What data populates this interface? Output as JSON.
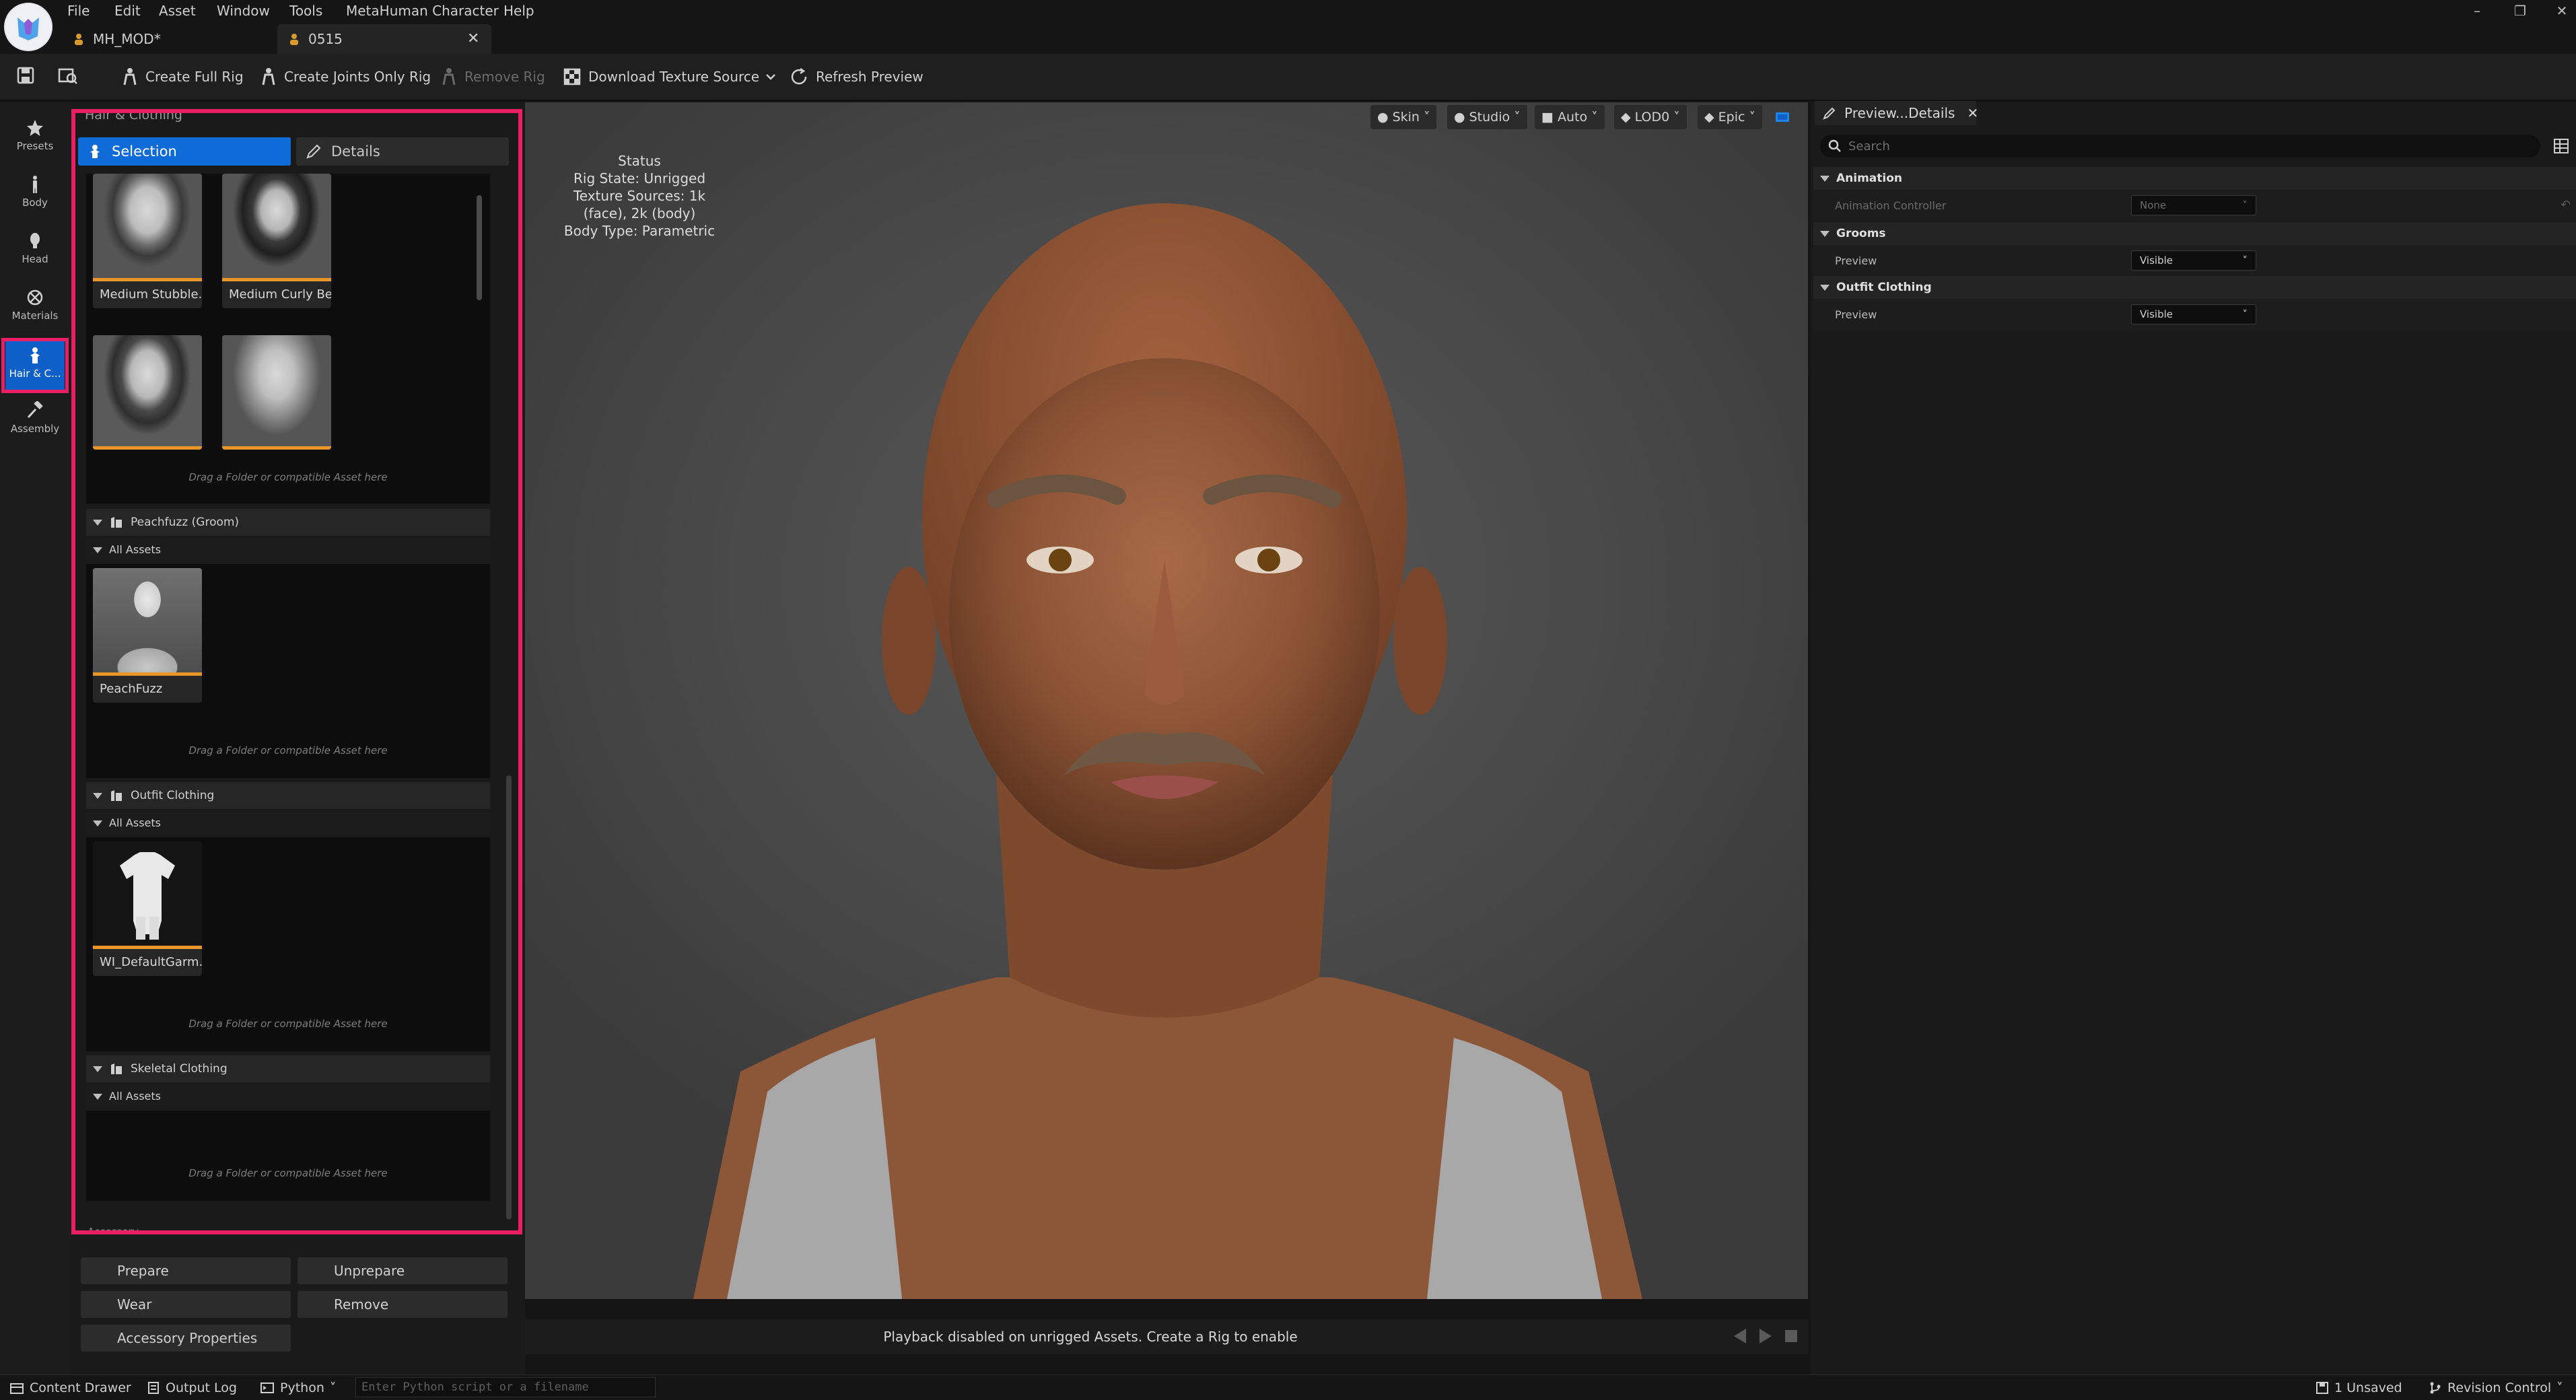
{
  "menu": [
    "File",
    "Edit",
    "Asset",
    "Window",
    "Tools",
    "MetaHuman Character",
    "Help"
  ],
  "tabs": [
    {
      "label": "MH_MOD*"
    },
    {
      "label": "0515"
    }
  ],
  "toolbar": {
    "create_full_rig": "Create Full Rig",
    "create_joints_only_rig": "Create Joints Only Rig",
    "remove_rig": "Remove Rig",
    "download_texture_source": "Download Texture Source",
    "refresh_preview": "Refresh Preview"
  },
  "modes": [
    {
      "label": "Presets",
      "icon": "star-icon"
    },
    {
      "label": "Body",
      "icon": "body-icon"
    },
    {
      "label": "Head",
      "icon": "head-icon"
    },
    {
      "label": "Materials",
      "icon": "materials-icon"
    },
    {
      "label": "Hair & C...",
      "icon": "hair-icon",
      "active": true
    },
    {
      "label": "Assembly",
      "icon": "hammer-icon"
    }
  ],
  "left_panel": {
    "title": "Hair & Clothing",
    "segments": [
      "Selection",
      "Details"
    ],
    "beard_thumbs": [
      "Medium Stubble...",
      "Medium Curly Be..."
    ],
    "drag_hint": "Drag a Folder or compatible Asset here",
    "sections": [
      {
        "title": "Peachfuzz (Groom)",
        "sub": "All Assets",
        "asset": "PeachFuzz"
      },
      {
        "title": "Outfit Clothing",
        "sub": "All Assets",
        "asset": "WI_DefaultGarm..."
      },
      {
        "title": "Skeletal Clothing",
        "sub": "All Assets"
      }
    ],
    "next_section": "Accessory",
    "buttons": {
      "prepare": "Prepare",
      "unprepare": "Unprepare",
      "wear": "Wear",
      "remove": "Remove",
      "accessory_properties": "Accessory Properties"
    }
  },
  "viewport": {
    "chips": [
      "Skin",
      "Studio",
      "Auto",
      "LOD0",
      "Epic"
    ],
    "status": {
      "title": "Status",
      "rig_state": "Rig State: Unrigged",
      "texture_sources": "Texture Sources: 1k (face), 2k (body)",
      "body_type": "Body Type: Parametric"
    },
    "playback_msg": "Playback disabled on unrigged Assets. Create a Rig to enable"
  },
  "details": {
    "tab_label": "Preview...Details",
    "search_placeholder": "Search",
    "categories": [
      {
        "name": "Animation",
        "rows": [
          {
            "label": "Animation Controller",
            "value": "None",
            "disabled": true
          }
        ]
      },
      {
        "name": "Grooms",
        "rows": [
          {
            "label": "Preview",
            "value": "Visible"
          }
        ]
      },
      {
        "name": "Outfit Clothing",
        "rows": [
          {
            "label": "Preview",
            "value": "Visible"
          }
        ]
      }
    ]
  },
  "statusbar": {
    "content_drawer": "Content Drawer",
    "output_log": "Output Log",
    "python": "Python",
    "python_placeholder": "Enter Python script or a filename",
    "unsaved": "1 Unsaved",
    "revision_control": "Revision Control"
  },
  "colors": {
    "accent": "#0f6bd8",
    "highlight": "#ea1e63",
    "thumb_underline": "#e89628"
  }
}
